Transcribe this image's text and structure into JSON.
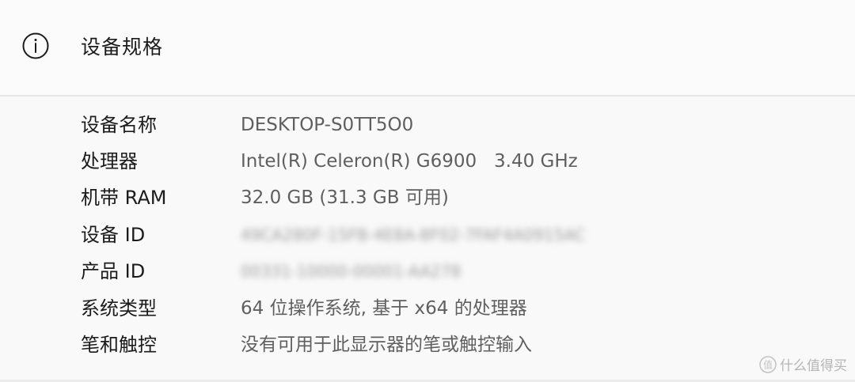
{
  "header": {
    "icon": "info-icon",
    "title": "设备规格"
  },
  "specs": [
    {
      "label": "设备名称",
      "value": "DESKTOP-S0TT5O0"
    },
    {
      "label": "处理器",
      "value": "Intel(R) Celeron(R) G6900   3.40 GHz"
    },
    {
      "label": "机带 RAM",
      "value": "32.0 GB (31.3 GB 可用)"
    },
    {
      "label": "设备 ID",
      "value": "49CA280F-15FB-4E8A-8F02-7FAF4A0915AC"
    },
    {
      "label": "产品 ID",
      "value": "00331-10000-00001-AA278"
    },
    {
      "label": "系统类型",
      "value": "64 位操作系统, 基于 x64 的处理器"
    },
    {
      "label": "笔和触控",
      "value": "没有可用于此显示器的笔或触控输入"
    }
  ],
  "watermark": {
    "logo": "值",
    "text": "什么值得买"
  }
}
